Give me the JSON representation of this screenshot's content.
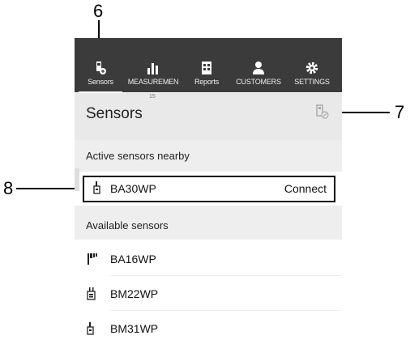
{
  "callouts": {
    "c6": "6",
    "c7": "7",
    "c8": "8"
  },
  "nav": {
    "tabs": [
      {
        "label": "Sensors",
        "icon": "sensor-icon"
      },
      {
        "label": "MEASUREMEN",
        "icon": "bar-chart-icon"
      },
      {
        "label": "Reports",
        "icon": "report-icon"
      },
      {
        "label": "CUSTOMERS",
        "icon": "person-icon"
      },
      {
        "label": "SETTINGS",
        "icon": "gear-icon"
      }
    ],
    "under_label": "15"
  },
  "header": {
    "title": "Sensors",
    "action_icon": "sensor-disconnect-icon"
  },
  "active_section": {
    "label": "Active sensors nearby",
    "items": [
      {
        "name": "BA30WP",
        "action": "Connect",
        "icon": "probe-icon"
      }
    ]
  },
  "available_section": {
    "label": "Available sensors",
    "items": [
      {
        "name": "BA16WP",
        "icon": "flag-probe-icon"
      },
      {
        "name": "BM22WP",
        "icon": "clip-probe-icon"
      },
      {
        "name": "BM31WP",
        "icon": "probe-icon"
      }
    ]
  },
  "colors": {
    "nav_bg": "#3b3b3b",
    "section_bg": "#eeeeee",
    "header_bg": "#e9e9e9"
  }
}
